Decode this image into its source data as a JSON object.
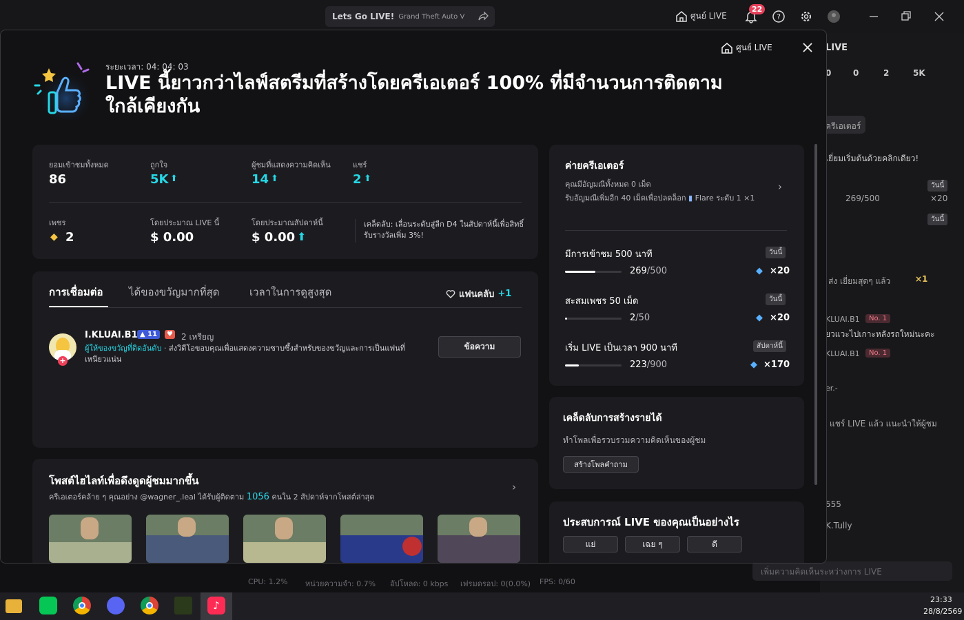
{
  "topbar": {
    "stream_title": "Lets Go LIVE!",
    "game": "Grand Theft Auto V",
    "hub_label": "ศูนย์ LIVE",
    "notif_count": "22"
  },
  "background": {
    "title": "LIVE",
    "stats": [
      "0",
      "0",
      "2",
      "5K"
    ],
    "creator_label": "ครีเอเตอร์",
    "invite": "เยี่ยมเริ่มต้นด้วยคลิกเดียว!",
    "today1": "วันนี้",
    "progress": "269/500",
    "gems": "×20",
    "today2": "วันนี้",
    "gift_text": "ส่ง เยี่ยมสุดๆ แล้ว",
    "gift_count": "×1",
    "c1_user": "KLUAI.B1",
    "c1_badge": "No. 1",
    "c1_text": "ยวแวะไปเกาะหลังรถใหม่นะคะ",
    "c2_user": "KLUAI.B1",
    "c2_badge": "No. 1",
    "user3": "er.-",
    "share_text": "แชร์ LIVE แล้ว แนะนำให้ผู้ชม",
    "n555": "555",
    "tully": "K.Tully",
    "input_placeholder": "เพิ่มความคิดเห็นระหว่างการ LIVE"
  },
  "bottom_stats": [
    "CPU: 1.2%",
    "หน่วยความจำ: 0.7%",
    "อัปโหลด: 0 kbps",
    "เฟรมดรอป: 0(0.0%)",
    "FPS: 0/60"
  ],
  "modal": {
    "hub_label": "ศูนย์ LIVE",
    "duration": "ระยะเวลา: 04: 04: 03",
    "headline": "LIVE นี้ยาวกว่าไลฟ์สตรีมที่สร้างโดยครีเอเตอร์ 100% ที่มีจำนวนการติดตามใกล้เคียงกัน",
    "stats": {
      "viewers_label": "ยอมเข้าชมทั้งหมด",
      "viewers": "86",
      "likes_label": "ถูกใจ",
      "likes": "5K",
      "commenters_label": "ผู้ชมที่แสดงความคิดเห็น",
      "commenters": "14",
      "shares_label": "แชร์",
      "shares": "2",
      "diamonds_label": "เพชร",
      "diamonds": "2",
      "est_live_label": "โดยประมาณ LIVE นี้",
      "est_live": "$ 0.00",
      "est_week_label": "โดยประมาณสัปดาห์นี้",
      "est_week": "$ 0.00",
      "tip": "เคล็ดลับ: เลื่อนระดับสู่ลีก D4 ในสัปดาห์นี้เพื่อสิทธิ์รับรางวัลเพิ่ม 3%!"
    },
    "tabs": [
      "การเชื่อมต่อ",
      "ได้ของขวัญมากที่สุด",
      "เวลาในการดูสูงสุด"
    ],
    "fan_club_label": "แฟนคลับ",
    "fan_club_count": "+1",
    "connection": {
      "name": "I.KLUAI.B1",
      "level": "11",
      "coins": "2 เหรียญ",
      "highlight": "ผู้ให้ของขวัญที่ติดอันดับ",
      "desc": " · ส่งวิดีโอขอบคุณเพื่อแสดงความซาบซึ้งสำหรับของขวัญและการเป็นแฟนที่เหนียวแน่น",
      "button": "ข้อความ"
    },
    "highlight": {
      "title": "โพสต์ไฮไลท์เพื่อดึงดูดผู้ชมมากขึ้น",
      "desc_pre": "ครีเอเตอร์คล้าย ๆ คุณอย่าง @wagner_.leal ได้รับผู้ติดตาม",
      "desc_num": "1056",
      "desc_post": "คนใน 2 สัปดาห์จากโพสต์ล่าสุด"
    },
    "creator_camp": {
      "title": "ค่ายครีเอเตอร์",
      "line1": "คุณมีอัญมณีทั้งหมด 0 เม็ด",
      "line2": "รับอัญมณีเพิ่มอีก 40 เม็ดเพื่อปลดล็อก",
      "line2b": "Flare ระดับ 1 ×1",
      "tasks": [
        {
          "title": "มีการเข้าชม 500 นาที",
          "tag": "วันนี้",
          "cur": "269",
          "total": "/500",
          "reward": "×20",
          "pct": 0.538
        },
        {
          "title": "สะสมเพชร 50 เม็ด",
          "tag": "วันนี้",
          "cur": "2",
          "total": "/50",
          "reward": "×20",
          "pct": 0.04
        },
        {
          "title": "เริ่ม LIVE เป็นเวลา 900 นาที",
          "tag": "สัปดาห์นี้",
          "cur": "223",
          "total": "/900",
          "reward": "×170",
          "pct": 0.248
        }
      ]
    },
    "income_tips": {
      "title": "เคล็ดลับการสร้างรายได้",
      "desc": "ทำโพลเพื่อรวบรวมความคิดเห็นของผู้ชม",
      "button": "สร้างโพลคำถาม"
    },
    "experience": {
      "title": "ประสบการณ์ LIVE ของคุณเป็นอย่างไร",
      "options": [
        "แย่",
        "เฉย ๆ",
        "ดี"
      ]
    }
  },
  "taskbar": {
    "time": "23:33",
    "date": "28/8/2569"
  }
}
